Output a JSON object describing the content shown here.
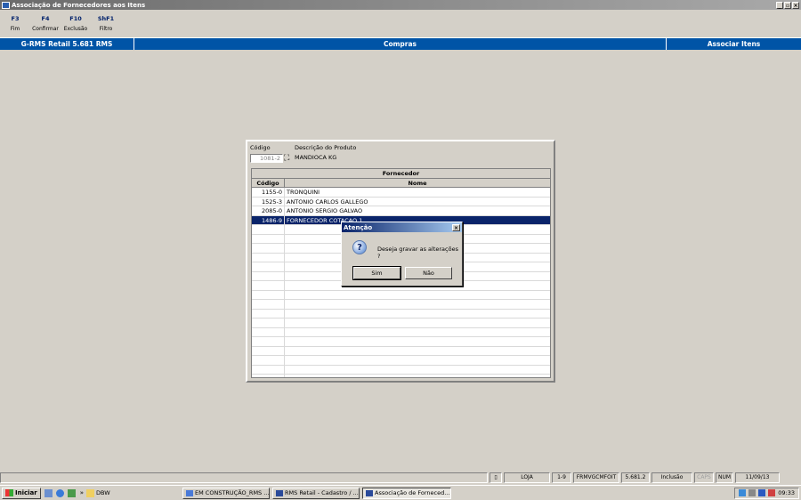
{
  "window": {
    "title": "Associação de Fornecedores aos Itens",
    "controls": [
      "_",
      "▫",
      "×"
    ]
  },
  "fkeys": [
    {
      "key": "F3",
      "label": "Fim"
    },
    {
      "key": "F4",
      "label": "Confirmar"
    },
    {
      "key": "F10",
      "label": "Exclusão"
    },
    {
      "key": "ShF1",
      "label": "Filtro"
    }
  ],
  "bluebar": {
    "left": "G-RMS Retail 5.681 RMS",
    "center": "Compras",
    "right": "Associar Itens"
  },
  "form": {
    "codigo_label": "Código",
    "descricao_label": "Descrição do Produto",
    "codigo_value": "1081-2",
    "descricao_value": "MANDIOCA KG"
  },
  "grid": {
    "group_header": "Fornecedor",
    "col_codigo": "Código",
    "col_nome": "Nome",
    "rows": [
      {
        "codigo": "1155-0",
        "nome": "TRONQUINI",
        "selected": false
      },
      {
        "codigo": "1525-3",
        "nome": "ANTONIO CARLOS GALLEGO",
        "selected": false
      },
      {
        "codigo": "2085-0",
        "nome": "ANTONIO SERGIO GALVAO",
        "selected": false
      },
      {
        "codigo": "1486-9",
        "nome": "FORNECEDOR COTACAO 1",
        "selected": true
      }
    ]
  },
  "dialog": {
    "title": "Atenção",
    "message": "Deseja gravar as alterações ?",
    "yes": "Sim",
    "no": "Não",
    "icon": "question-icon"
  },
  "statusbar": {
    "loja": "LOJA",
    "range": "1-9",
    "form_id": "FRMVGCMFOIT",
    "version": "5.681.2",
    "mode": "Inclusão",
    "caps": "CAPS",
    "num": "NUM",
    "date": "11/09/13"
  },
  "taskbar": {
    "start": "Iniciar",
    "folder": "DBW",
    "tasks": [
      "EM CONSTRUÇÃO_RMS ...",
      "RMS Retail - Cadastro / ...",
      "Associação de Forneced..."
    ],
    "time": "09:33"
  }
}
